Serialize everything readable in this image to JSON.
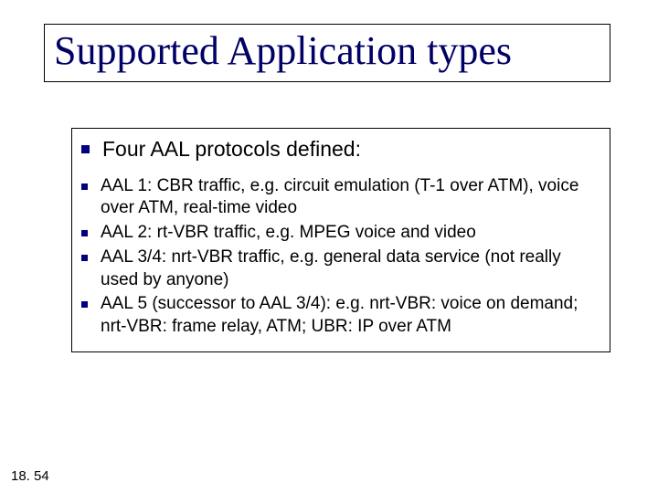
{
  "title": "Supported Application types",
  "lead": "Four AAL protocols defined:",
  "items": [
    "AAL 1: CBR traffic, e.g. circuit emulation (T-1 over ATM), voice over ATM, real-time video",
    "AAL 2: rt-VBR traffic, e.g. MPEG voice and video",
    "AAL 3/4: nrt-VBR traffic, e.g. general data service (not really used by anyone)",
    "AAL 5 (successor to AAL 3/4): e.g. nrt-VBR: voice on demand; nrt-VBR: frame relay, ATM; UBR: IP over ATM"
  ],
  "slide_number": "18. 54"
}
